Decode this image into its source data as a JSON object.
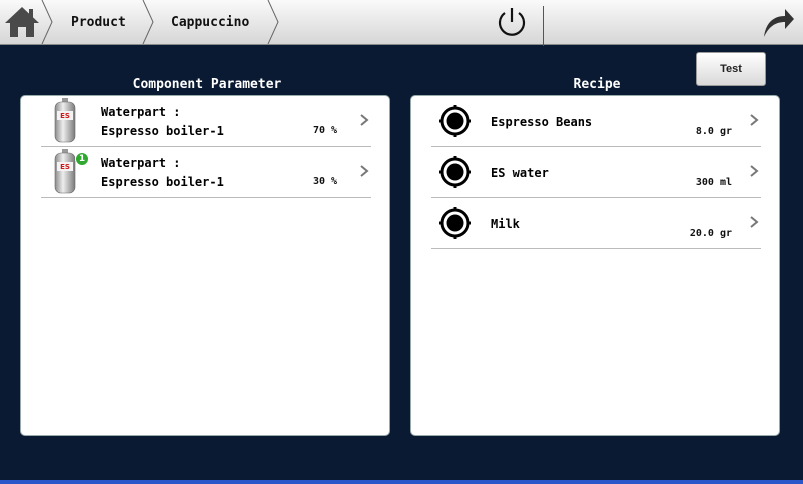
{
  "breadcrumb": {
    "items": [
      "Product",
      "Cappuccino"
    ]
  },
  "toolbar": {
    "test_label": "Test"
  },
  "component_parameter": {
    "title": "Component Parameter",
    "items": [
      {
        "title": "Waterpart :",
        "name": "Espresso boiler-1",
        "value": "70 %",
        "badge": ""
      },
      {
        "title": "Waterpart :",
        "name": "Espresso boiler-1",
        "value": "30 %",
        "badge": "1"
      }
    ]
  },
  "recipe": {
    "title": "Recipe",
    "items": [
      {
        "name": "Espresso Beans",
        "value": "8.0 gr"
      },
      {
        "name": "ES water",
        "value": "300 ml"
      },
      {
        "name": "Milk",
        "value": "20.0 gr"
      }
    ]
  },
  "icons": {
    "home": "home-icon",
    "power": "power-icon",
    "back": "back-arrow-icon",
    "cylinder": "boiler-cylinder-icon",
    "ingredient": "ingredient-circle-icon",
    "chevron": "chevron-right-icon"
  },
  "colors": {
    "background": "#0a1a33",
    "panel": "#ffffff",
    "badge": "#2fa82f",
    "cylinder_label": "#d01818"
  }
}
